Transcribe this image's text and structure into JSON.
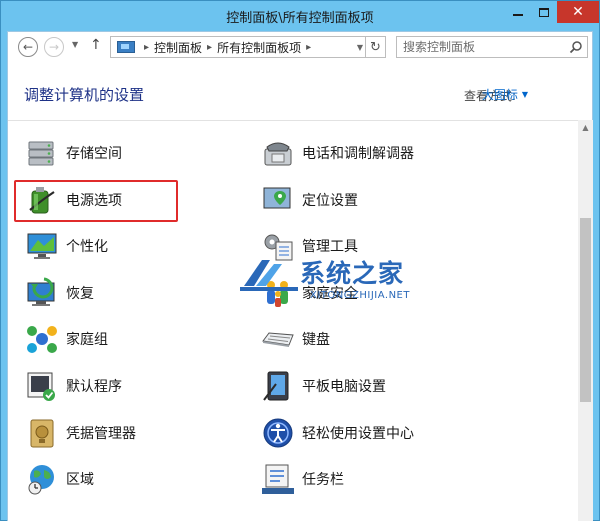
{
  "window": {
    "title": "控制面板\\所有控制面板项",
    "close_glyph": "✕"
  },
  "nav": {
    "back_glyph": "←",
    "forward_glyph": "→",
    "up_glyph": "↑",
    "breadcrumbs": [
      "控制面板",
      "所有控制面板项"
    ],
    "refresh_glyph": "↻",
    "search_placeholder": "搜索控制面板"
  },
  "header": {
    "heading": "调整计算机的设置",
    "view_by_label": "查看方式:",
    "view_by_value": "大图标"
  },
  "items": {
    "storage": "存储空间",
    "phone_modem": "电话和调制解调器",
    "power": "电源选项",
    "location": "定位设置",
    "personalization": "个性化",
    "admin_tools": "管理工具",
    "recovery": "恢复",
    "family_safety": "家庭安全",
    "homegroup": "家庭组",
    "keyboard": "键盘",
    "default_programs": "默认程序",
    "tablet_settings": "平板电脑设置",
    "credential_manager": "凭据管理器",
    "ease_of_access": "轻松使用设置中心",
    "region": "区域",
    "taskbar": "任务栏"
  },
  "watermark": {
    "name": "系统之家",
    "url": "XITONGZHIJIA.NET"
  },
  "colors": {
    "accent_link": "#0066cc",
    "heading": "#1e3287",
    "highlight_border": "#e02b2b",
    "close_button": "#c7362b",
    "window_frame": "#6cc3ef"
  }
}
